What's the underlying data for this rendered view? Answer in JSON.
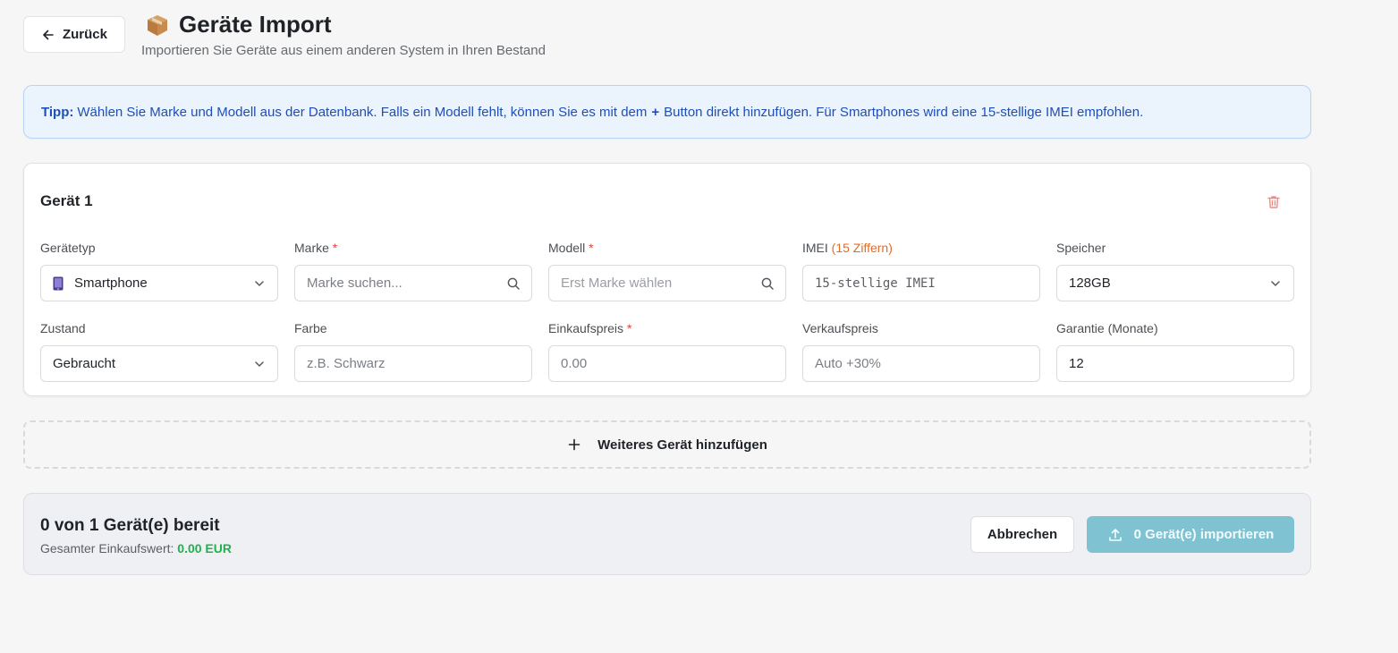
{
  "header": {
    "back_label": "Zurück",
    "title": "Geräte Import",
    "subtitle": "Importieren Sie Geräte aus einem anderen System in Ihren Bestand"
  },
  "tip": {
    "prefix": "Tipp:",
    "text_before_plus": "Wählen Sie Marke und Modell aus der Datenbank. Falls ein Modell fehlt, können Sie es mit dem",
    "plus": "+",
    "text_after_plus": "Button direkt hinzufügen. Für Smartphones wird eine 15-stellige IMEI empfohlen."
  },
  "device": {
    "title": "Gerät 1",
    "fields": {
      "type": {
        "label": "Gerätetyp",
        "value": "Smartphone"
      },
      "brand": {
        "label": "Marke",
        "required": "*",
        "placeholder": "Marke suchen..."
      },
      "model": {
        "label": "Modell",
        "required": "*",
        "placeholder": "Erst Marke wählen"
      },
      "imei": {
        "label": "IMEI",
        "hint": "(15 Ziffern)",
        "placeholder": "15-stellige IMEI"
      },
      "storage": {
        "label": "Speicher",
        "value": "128GB"
      },
      "condition": {
        "label": "Zustand",
        "value": "Gebraucht"
      },
      "color": {
        "label": "Farbe",
        "placeholder": "z.B. Schwarz"
      },
      "purchase_price": {
        "label": "Einkaufspreis",
        "required": "*",
        "placeholder": "0.00"
      },
      "sale_price": {
        "label": "Verkaufspreis",
        "placeholder": "Auto +30%"
      },
      "warranty": {
        "label": "Garantie (Monate)",
        "value": "12"
      }
    }
  },
  "add_device_label": "Weiteres Gerät hinzufügen",
  "footer": {
    "ready_text": "0 von 1 Gerät(e) bereit",
    "total_label": "Gesamter Einkaufswert:",
    "total_value": "0.00 EUR",
    "cancel_label": "Abbrechen",
    "import_label": "0 Gerät(e) importieren"
  },
  "colors": {
    "accent": "#7fc3d3",
    "required": "#e0443f",
    "hint": "#e56b1f",
    "total_value": "#22b14c",
    "tip_text": "#1e4fb8"
  },
  "icons": {
    "back": "arrow-left-icon",
    "title": "package-icon",
    "delete": "trash-icon",
    "device_type": "smartphone-icon",
    "search": "search-icon",
    "dropdown": "chevron-down-icon",
    "add": "plus-icon",
    "import": "upload-icon"
  }
}
